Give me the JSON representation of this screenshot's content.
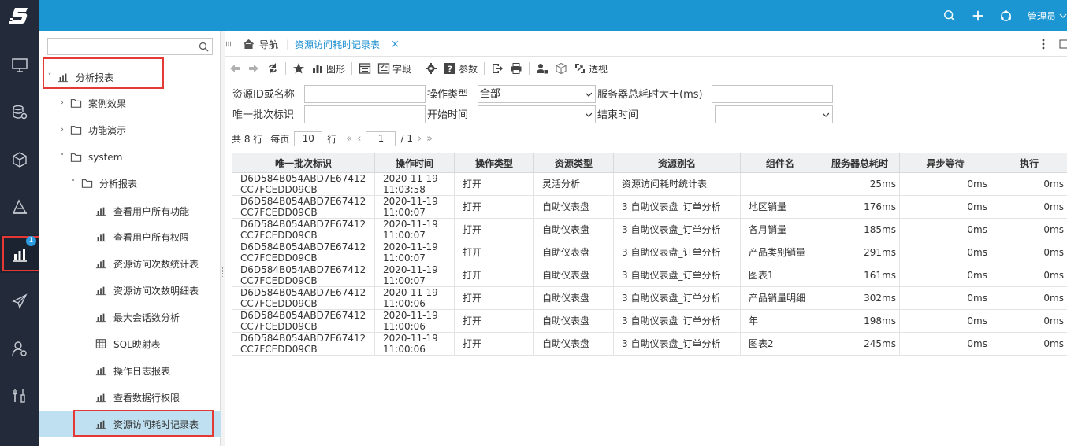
{
  "topbar": {
    "user_label": "管理员"
  },
  "rail": {
    "badge": "1"
  },
  "tree": {
    "items": [
      {
        "label": "分析报表"
      },
      {
        "label": "案例效果"
      },
      {
        "label": "功能演示"
      },
      {
        "label": "system"
      },
      {
        "label": "分析报表"
      },
      {
        "label": "查看用户所有功能"
      },
      {
        "label": "查看用户所有权限"
      },
      {
        "label": "资源访问次数统计表"
      },
      {
        "label": "资源访问次数明细表"
      },
      {
        "label": "最大会话数分析"
      },
      {
        "label": "SQL映射表"
      },
      {
        "label": "操作日志报表"
      },
      {
        "label": "查看数据行权限"
      },
      {
        "label": "资源访问耗时记录表"
      }
    ]
  },
  "tabs": {
    "nav_label": "导航",
    "active_label": "资源访问耗时记录表",
    "close": "×"
  },
  "toolbar": {
    "chart": "图形",
    "fields": "字段",
    "params": "参数",
    "pivot": "透视"
  },
  "filters": {
    "resource_id_label": "资源ID或名称",
    "op_type_label": "操作类型",
    "op_type_value": "全部",
    "server_time_label": "服务器总耗时大于(ms)",
    "batch_id_label": "唯一批次标识",
    "start_time_label": "开始时间",
    "end_time_label": "结束时间"
  },
  "pager": {
    "total": "共 8 行",
    "per_page_label": "每页",
    "per_page": "10",
    "rows_label": "行",
    "page": "1",
    "page_total": "/ 1"
  },
  "table": {
    "headers": [
      "唯一批次标识",
      "操作时间",
      "操作类型",
      "资源类型",
      "资源别名",
      "组件名",
      "服务器总耗时",
      "异步等待",
      "执行"
    ],
    "rows": [
      [
        "D6D584B054ABD7E67412CC7FCEDD09CB",
        "2020-11-19 11:03:58",
        "打开",
        "灵活分析",
        "资源访问耗时统计表",
        "",
        "25ms",
        "0ms",
        "0ms"
      ],
      [
        "D6D584B054ABD7E67412CC7FCEDD09CB",
        "2020-11-19 11:00:07",
        "打开",
        "自助仪表盘",
        "3 自助仪表盘_订单分析",
        "地区销量",
        "176ms",
        "0ms",
        "0ms"
      ],
      [
        "D6D584B054ABD7E67412CC7FCEDD09CB",
        "2020-11-19 11:00:07",
        "打开",
        "自助仪表盘",
        "3 自助仪表盘_订单分析",
        "各月销量",
        "185ms",
        "0ms",
        "0ms"
      ],
      [
        "D6D584B054ABD7E67412CC7FCEDD09CB",
        "2020-11-19 11:00:07",
        "打开",
        "自助仪表盘",
        "3 自助仪表盘_订单分析",
        "产品类别销量",
        "291ms",
        "0ms",
        "0ms"
      ],
      [
        "D6D584B054ABD7E67412CC7FCEDD09CB",
        "2020-11-19 11:00:07",
        "打开",
        "自助仪表盘",
        "3 自助仪表盘_订单分析",
        "图表1",
        "161ms",
        "0ms",
        "0ms"
      ],
      [
        "D6D584B054ABD7E67412CC7FCEDD09CB",
        "2020-11-19 11:00:06",
        "打开",
        "自助仪表盘",
        "3 自助仪表盘_订单分析",
        "产品销量明细",
        "302ms",
        "0ms",
        "0ms"
      ],
      [
        "D6D584B054ABD7E67412CC7FCEDD09CB",
        "2020-11-19 11:00:06",
        "打开",
        "自助仪表盘",
        "3 自助仪表盘_订单分析",
        "年",
        "198ms",
        "0ms",
        "0ms"
      ],
      [
        "D6D584B054ABD7E67412CC7FCEDD09CB",
        "2020-11-19 11:00:06",
        "打开",
        "自助仪表盘",
        "3 自助仪表盘_订单分析",
        "图表2",
        "245ms",
        "0ms",
        "0ms"
      ]
    ]
  }
}
